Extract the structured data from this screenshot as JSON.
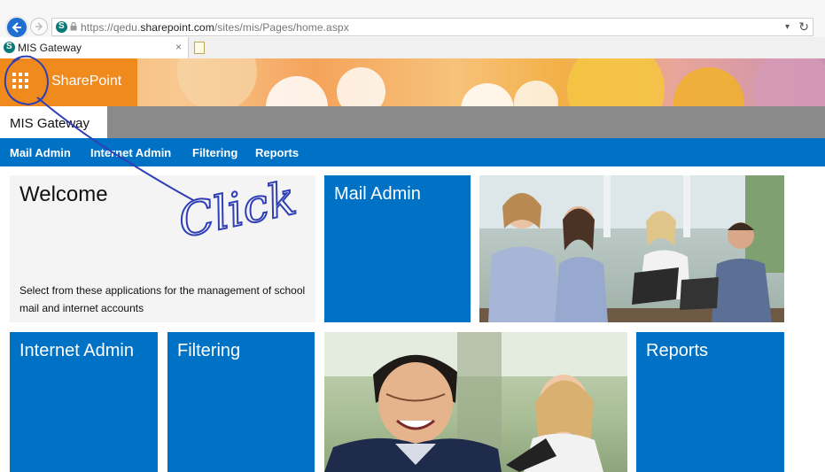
{
  "browser": {
    "url_prefix": "https://qedu.",
    "url_host": "sharepoint.com",
    "url_path": "/sites/mis/Pages/home.aspx",
    "dropdown_glyph": "▾",
    "refresh_glyph": "↻",
    "tab": {
      "title": "MIS Gateway",
      "close": "×"
    }
  },
  "suite": {
    "brand": "SharePoint"
  },
  "site": {
    "title": "MIS Gateway"
  },
  "nav": {
    "items": [
      "Mail Admin",
      "Internet Admin",
      "Filtering",
      "Reports"
    ]
  },
  "tiles": {
    "welcome": {
      "title": "Welcome",
      "text": "Select from these applications for the management of school mail and internet accounts"
    },
    "mail_admin": "Mail Admin",
    "internet_admin": "Internet Admin",
    "filtering": "Filtering",
    "reports": "Reports"
  },
  "annotation": {
    "text": "Click"
  },
  "colors": {
    "sharepoint_orange": "#f08a1c",
    "nav_blue": "#0072c6",
    "tile_blue": "#0072c6",
    "title_bar_gray": "#8a8a8a",
    "ink_blue": "#2f3fb5"
  },
  "icons": [
    "back-arrow-icon",
    "forward-arrow-icon",
    "sharepoint-favicon-icon",
    "lock-icon",
    "refresh-icon",
    "app-launcher-waffle-icon",
    "new-tab-icon"
  ]
}
